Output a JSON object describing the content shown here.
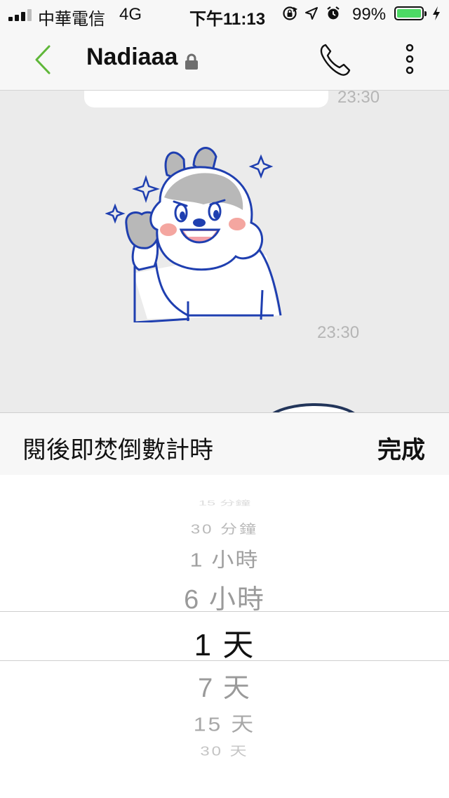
{
  "status_bar": {
    "carrier": "中華電信",
    "network": "4G",
    "time": "下午11:13",
    "battery_percent": "99%",
    "icons": [
      "rotation-lock-icon",
      "location-arrow-icon",
      "alarm-icon",
      "battery-icon",
      "charging-bolt-icon"
    ]
  },
  "header": {
    "title": "Nadiaaa",
    "icons": [
      "back-chevron-icon",
      "lock-icon",
      "phone-icon",
      "more-vertical-icon"
    ]
  },
  "chat": {
    "messages": [
      {
        "type": "text",
        "time": "23:30"
      },
      {
        "type": "sticker",
        "sticker": "squirrel-flexing-sticker",
        "time": "23:30"
      }
    ]
  },
  "picker": {
    "title": "閱後即焚倒數計時",
    "done_label": "完成",
    "options": [
      "15 分鐘",
      "30 分鐘",
      "1 小時",
      "6 小時",
      "1 天",
      "7 天",
      "15 天",
      "30 天"
    ],
    "selected": "1 天"
  },
  "colors": {
    "accent_green": "#5fb739",
    "sticker_blue": "#1f3fb0",
    "battery_green": "#4cd964",
    "chat_background": "#ebebeb"
  }
}
